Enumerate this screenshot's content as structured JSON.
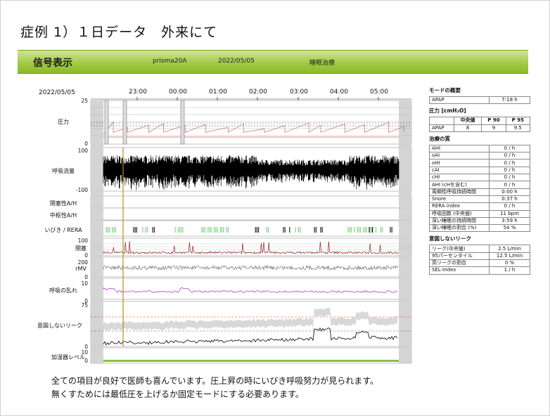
{
  "slide_title": "症例 1）１日データ　外来にて",
  "banner": {
    "title": "信号表示",
    "device": "prisma20A",
    "date": "2022/05/05",
    "mode": "睡眠治療"
  },
  "chart": {
    "date": "2022/05/05",
    "times": [
      "23:00",
      "00:00",
      "01:00",
      "02:00",
      "03:00",
      "04:00",
      "05:00"
    ],
    "rows": {
      "pressure": {
        "label": "圧力",
        "max": "25",
        "min": "0"
      },
      "flow": {
        "label": "呼吸流量",
        "max": "100",
        "min": "-100"
      },
      "oa": {
        "label": "閉塞性A/H"
      },
      "ca": {
        "label": "中枢性A/H"
      },
      "snore": {
        "label": "いびき / RERA"
      },
      "obst": {
        "label": "閉塞",
        "max": "100",
        "min": "0"
      },
      "rmv": {
        "label": "rMV",
        "max": "200",
        "min": "0"
      },
      "disorder": {
        "label": "呼吸の乱れ",
        "max": "10",
        "min": "0"
      },
      "leak": {
        "label": "意図しないリーク",
        "max": "75",
        "min": "0"
      },
      "humid": {
        "label": "加湿器レベル",
        "max": "10",
        "min": "0"
      }
    }
  },
  "side": {
    "mode_section": {
      "title": "モードの概要",
      "rows": [
        {
          "label": "APAP",
          "value": "7:18 h"
        }
      ]
    },
    "pressure_section": {
      "title": "圧力 [cmH₂O]",
      "headers": [
        "",
        "中央値",
        "P 90",
        "P 95"
      ],
      "rows": [
        {
          "label": "APAP",
          "median": "8",
          "p90": "9",
          "p95": "9.5"
        }
      ]
    },
    "therapy_section": {
      "title": "治療の質",
      "rows": [
        {
          "label": "AHI",
          "value": "0 / h"
        },
        {
          "label": "oAI",
          "value": "0 / h"
        },
        {
          "label": "oHI",
          "value": "0 / h"
        },
        {
          "label": "cAI",
          "value": "0 / h"
        },
        {
          "label": "cHI",
          "value": "0 / h"
        },
        {
          "label": "AHI (cHを含む)",
          "value": "0 / h"
        },
        {
          "label": "周期性呼吸持続時間",
          "value": "0:00 h"
        },
        {
          "label": "Snore",
          "value": "0:37 h"
        },
        {
          "label": "RERA index",
          "value": "0 / h"
        },
        {
          "label": "呼吸回数 (中央値)",
          "value": "11 bpm"
        },
        {
          "label": "深い睡眠の持続時間",
          "value": "3:59 h"
        },
        {
          "label": "深い睡眠の割合 (%)",
          "value": "54 %"
        }
      ]
    },
    "leak_section": {
      "title": "意図しないリーク",
      "rows": [
        {
          "label": "リーク(中央値)",
          "value": "2.5 L/min"
        },
        {
          "label": "95パーセンタイル",
          "value": "12.5 L/min"
        },
        {
          "label": "高リークの割合",
          "value": "0 %"
        },
        {
          "label": "SEL-Index",
          "value": "1 / h"
        }
      ]
    }
  },
  "caption": {
    "line1": "全ての項目が良好で医師も喜んでいます。圧上昇の時にいびき呼吸努力が見られます。",
    "line2": "無くすためには最低圧を上げるか固定モードにする必要あります。"
  }
}
